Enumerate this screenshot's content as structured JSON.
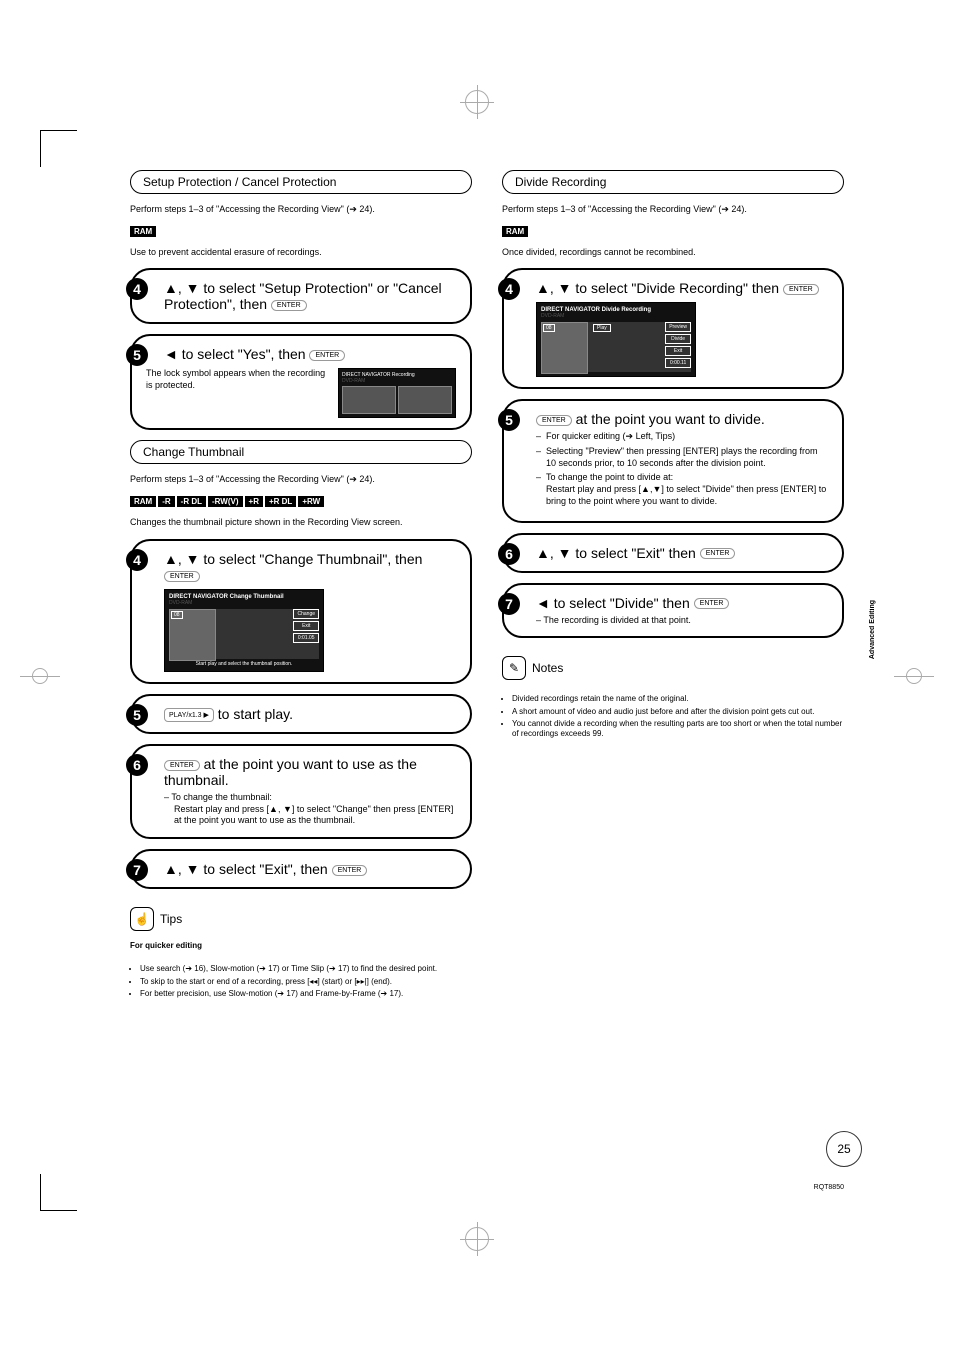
{
  "left": {
    "sec1": {
      "title": "Setup Protection / Cancel Protection",
      "intro1": "Perform steps 1–3 of \"Accessing the Recording View\" (➔ 24).",
      "desc": "Use to prevent accidental erasure of recordings.",
      "step4": "▲, ▼ to select \"Setup Protection\" or \"Cancel Protection\", then ",
      "step5": "◄ to select \"Yes\", then ",
      "lock_text": "The lock symbol appears when the recording is protected.",
      "osd_title": "DIRECT NAVIGATOR    Recording",
      "osd_sub": "DVD-RAM"
    },
    "sec2": {
      "title": "Change Thumbnail",
      "intro1": "Perform steps 1–3 of \"Accessing the Recording View\" (➔ 24).",
      "desc": "Changes the thumbnail picture shown in the Recording View screen.",
      "step4": "▲, ▼ to select \"Change Thumbnail\", then ",
      "osd_title": "DIRECT NAVIGATOR    Change Thumbnail",
      "osd_sub": "DVD-RAM",
      "osd_num": "08",
      "osd_menu_change": "Change",
      "osd_menu_exit": "Exit",
      "osd_time": "0:01.05",
      "osd_caption": "Start play and select the thumbnail position.",
      "step5": " to start play.",
      "step6": " at the point you want to use as the thumbnail.",
      "sub6_head": "– To change the thumbnail:",
      "sub6_body": "Restart play and press [▲, ▼] to select \"Change\" then press [ENTER] at the point you want to use as the thumbnail.",
      "step7": "▲, ▼ to select \"Exit\", then "
    },
    "tips": {
      "head": "Tips",
      "title": "For quicker editing",
      "b1": "Use search (➔ 16), Slow-motion (➔ 17) or Time Slip (➔ 17) to find the desired point.",
      "b2": "To skip to the start or end of a recording, press [◂◂] (start) or [▸▸|] (end).",
      "b3": "For better precision, use Slow-motion (➔ 17) and Frame-by-Frame (➔ 17)."
    }
  },
  "right": {
    "sec1": {
      "title": "Divide Recording",
      "intro1": "Perform steps 1–3 of \"Accessing the Recording View\" (➔ 24).",
      "desc": "Once divided, recordings cannot be recombined.",
      "step4": "▲, ▼ to select \"Divide Recording\" then ",
      "osd_title": "DIRECT NAVIGATOR    Divide Recording",
      "osd_sub": "DVD-RAM",
      "osd_num": "08",
      "osd_play": "Play",
      "osd_menu_preview": "Preview",
      "osd_menu_divide": "Divide",
      "osd_menu_exit": "Exit",
      "osd_time": "0:00.11",
      "step5": " at the point you want to divide.",
      "li1": "For quicker editing (➔ Left, Tips)",
      "li2": "Selecting \"Preview\" then pressing [ENTER] plays the recording from 10 seconds prior, to 10 seconds after the division point.",
      "li3_a": "To change the point to divide at:",
      "li3_b": "Restart play and press [▲,▼] to select \"Divide\" then press [ENTER] to bring to the point where you want to divide.",
      "step6": "▲, ▼ to select \"Exit\" then ",
      "step7": "◄ to select \"Divide\" then ",
      "sub7": "– The recording is divided at that point."
    },
    "notes": {
      "head": "Notes",
      "b1": "Divided recordings retain the name of the original.",
      "b2": "A short amount of video and audio just before and after the division point gets cut out.",
      "b3": "You cannot divide a recording when the resulting parts are too short or when the total number of recordings exceeds 99."
    }
  },
  "badges": {
    "ram": "RAM",
    "r": "-R",
    "rdl": "-R DL",
    "rwv": "-RW(V)",
    "pr": "+R",
    "prdl": "+R DL",
    "prw": "+RW"
  },
  "buttons": {
    "enter": "ENTER",
    "play": "PLAY/x1.3 ▶"
  },
  "meta": {
    "side_tab": "Advanced Editing",
    "page": "25",
    "code": "RQT8850"
  }
}
